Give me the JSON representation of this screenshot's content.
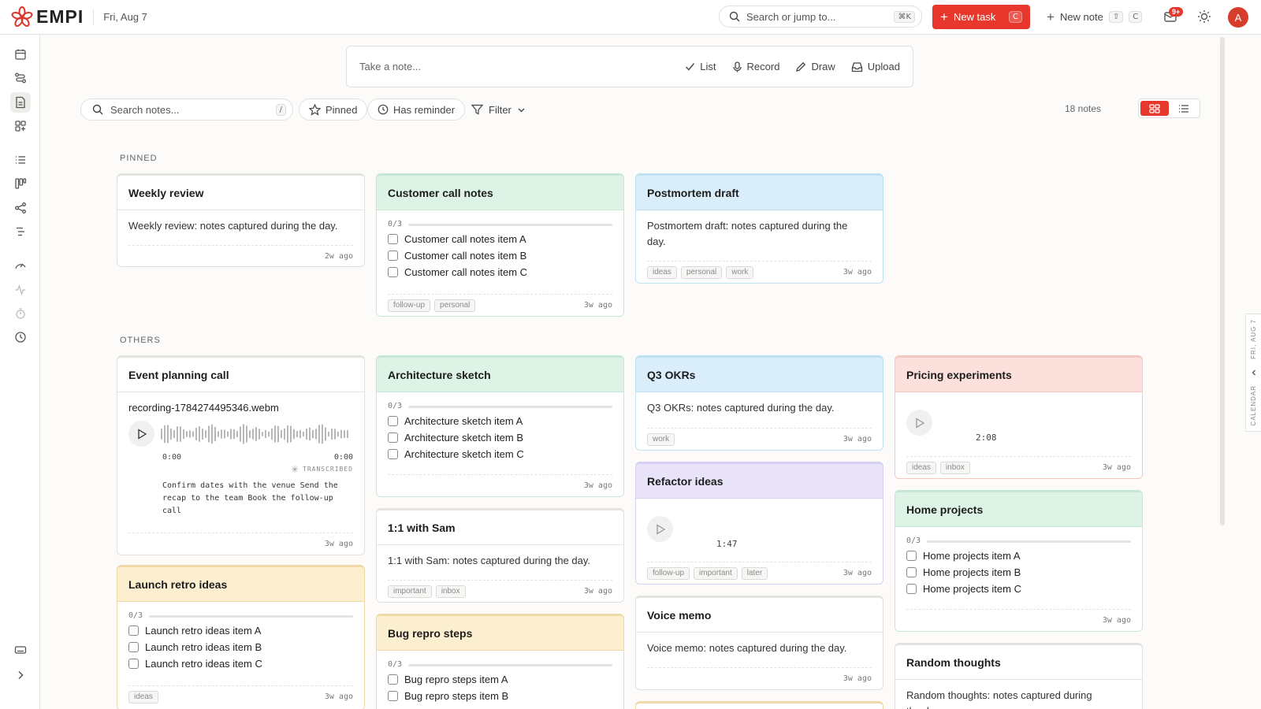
{
  "header": {
    "logo": "EMPI",
    "date": "Fri, Aug 7",
    "search_placeholder": "Search or jump to...",
    "search_kbd": "⌘K",
    "new_task_label": "New task",
    "new_task_kbd": "C",
    "new_note_label": "New note",
    "new_note_kbd": "C",
    "notification_badge": "9+",
    "avatar_letter": "A"
  },
  "composer": {
    "placeholder": "Take a note...",
    "actions": [
      "List",
      "Record",
      "Draw",
      "Upload"
    ]
  },
  "filters": {
    "search_placeholder": "Search notes...",
    "search_kbd": "/",
    "pinned": "Pinned",
    "has_reminder": "Has reminder",
    "filter": "Filter",
    "count": "18 notes"
  },
  "sections": {
    "pinned": "PINNED",
    "others": "OTHERS"
  },
  "calendar_tab": {
    "date": "FRI, AUG 7",
    "label": "CALENDAR"
  },
  "cards": {
    "weekly": {
      "title": "Weekly review",
      "text": "Weekly review: notes captured during the day.",
      "ago": "2w ago"
    },
    "customer": {
      "title": "Customer call notes",
      "progress": "0/3",
      "items": [
        "Customer call notes item A",
        "Customer call notes item B",
        "Customer call notes item C"
      ],
      "tags": [
        "follow-up",
        "personal"
      ],
      "ago": "3w ago"
    },
    "postmortem": {
      "title": "Postmortem draft",
      "text": "Postmortem draft: notes captured during the day.",
      "tags": [
        "ideas",
        "personal",
        "work"
      ],
      "ago": "3w ago"
    },
    "event": {
      "title": "Event planning call",
      "file": "recording-1784274495346.webm",
      "time_start": "0:00",
      "time_end": "0:00",
      "transcribed": "TRANSCRIBED",
      "transcript": "Confirm dates with the venue Send the recap to the team Book the follow-up call",
      "ago": "3w ago"
    },
    "launch": {
      "title": "Launch retro ideas",
      "progress": "0/3",
      "items": [
        "Launch retro ideas item A",
        "Launch retro ideas item B",
        "Launch retro ideas item C"
      ],
      "tags": [
        "ideas"
      ],
      "ago": "3w ago"
    },
    "architecture": {
      "title": "Architecture sketch",
      "progress": "0/3",
      "items": [
        "Architecture sketch item A",
        "Architecture sketch item B",
        "Architecture sketch item C"
      ],
      "ago": "3w ago"
    },
    "sam": {
      "title": "1:1 with Sam",
      "text": "1:1 with Sam: notes captured during the day.",
      "tags": [
        "important",
        "inbox"
      ],
      "ago": "3w ago"
    },
    "bug": {
      "title": "Bug repro steps",
      "progress": "0/3",
      "items": [
        "Bug repro steps item A",
        "Bug repro steps item B"
      ]
    },
    "okrs": {
      "title": "Q3 OKRs",
      "text": "Q3 OKRs: notes captured during the day.",
      "tags": [
        "work"
      ],
      "ago": "3w ago"
    },
    "refactor": {
      "title": "Refactor ideas",
      "duration": "1:47",
      "tags": [
        "follow-up",
        "important",
        "later"
      ],
      "ago": "3w ago"
    },
    "voice": {
      "title": "Voice memo",
      "text": "Voice memo: notes captured during the day.",
      "ago": "3w ago"
    },
    "pricing": {
      "title": "Pricing experiments",
      "duration": "2:08",
      "tags": [
        "ideas",
        "inbox"
      ],
      "ago": "3w ago"
    },
    "home": {
      "title": "Home projects",
      "progress": "0/3",
      "items": [
        "Home projects item A",
        "Home projects item B",
        "Home projects item C"
      ],
      "ago": "3w ago"
    },
    "random": {
      "title": "Random thoughts",
      "text": "Random thoughts: notes captured during the day."
    }
  },
  "colors": {
    "accent": "#e8372c",
    "green": "#dcf3e6",
    "blue": "#d9eefa",
    "red": "#fbe0dc",
    "purple": "#e8e3f8",
    "yellow": "#fcefcf"
  }
}
